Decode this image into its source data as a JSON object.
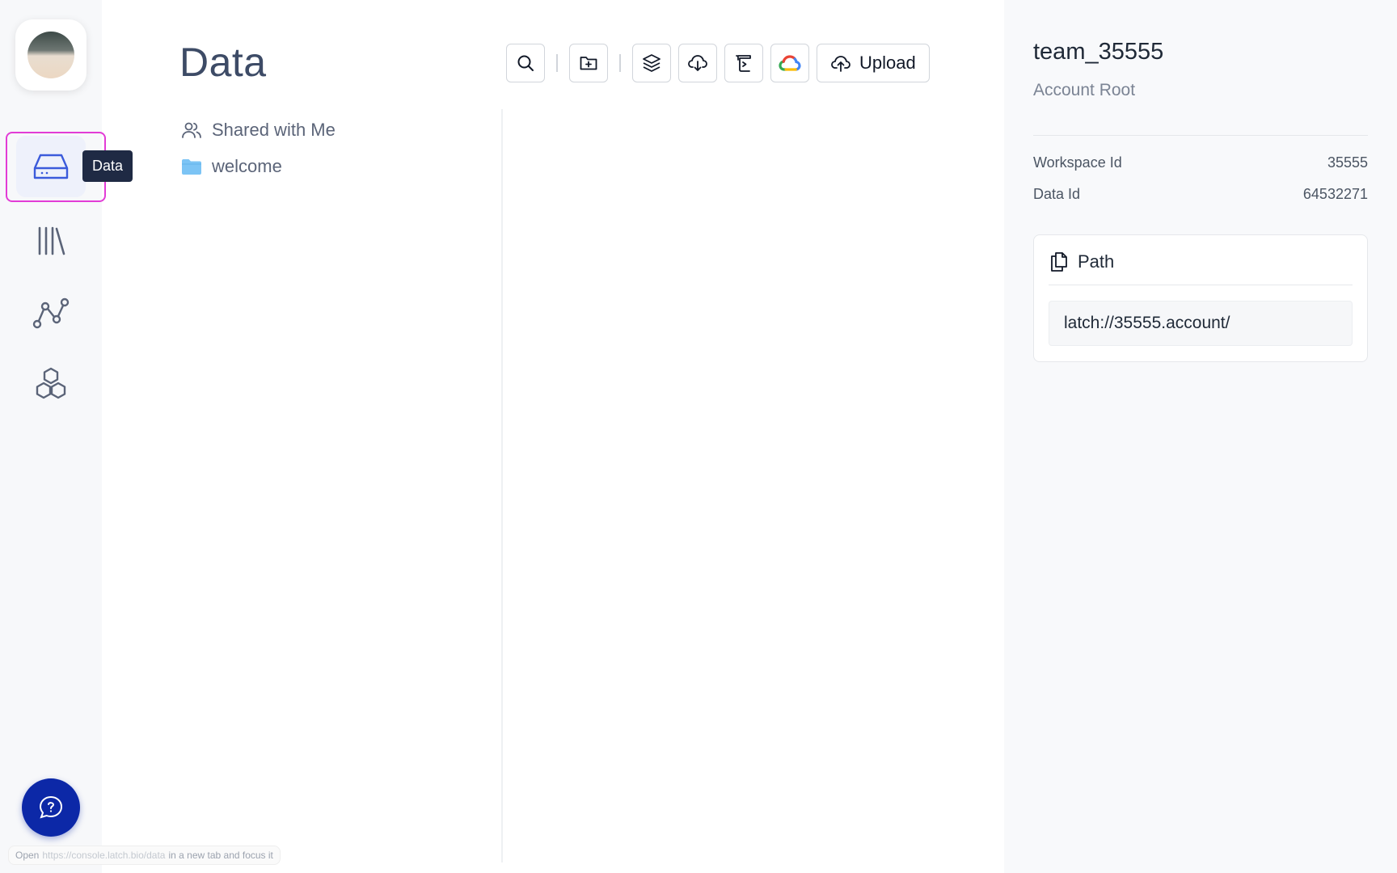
{
  "nav": {
    "items": [
      {
        "name": "data",
        "icon": "drive-icon",
        "active": true
      },
      {
        "name": "library",
        "icon": "library-icon",
        "active": false
      },
      {
        "name": "workflows",
        "icon": "graph-icon",
        "active": false
      },
      {
        "name": "registry",
        "icon": "hexagons-icon",
        "active": false
      }
    ],
    "tooltip": "Data",
    "help_icon": "chat-help-icon"
  },
  "main": {
    "title": "Data",
    "toolbar": {
      "buttons": [
        "search-icon",
        "new-folder-icon",
        "layers-icon",
        "cloud-download-icon",
        "script-icon",
        "google-cloud-icon"
      ],
      "upload_label": "Upload"
    },
    "tree": [
      {
        "label": "Shared with Me",
        "icon": "users-icon"
      },
      {
        "label": "welcome",
        "icon": "folder-icon"
      }
    ]
  },
  "panel": {
    "title": "team_35555",
    "subtitle": "Account Root",
    "meta": [
      {
        "label": "Workspace Id",
        "value": "35555"
      },
      {
        "label": "Data Id",
        "value": "64532271"
      }
    ],
    "path": {
      "label": "Path",
      "value": "latch://35555.account/"
    }
  },
  "status_hint": {
    "prefix": "Open",
    "url": "https://console.latch.bio/data",
    "suffix": "in a new tab and focus it"
  },
  "colors": {
    "accent": "#3b5bdb",
    "help_button": "#0c28a7",
    "focus_ring": "#e23cd6",
    "tooltip_bg": "#1f2a44",
    "folder": "#7cc4f5"
  }
}
